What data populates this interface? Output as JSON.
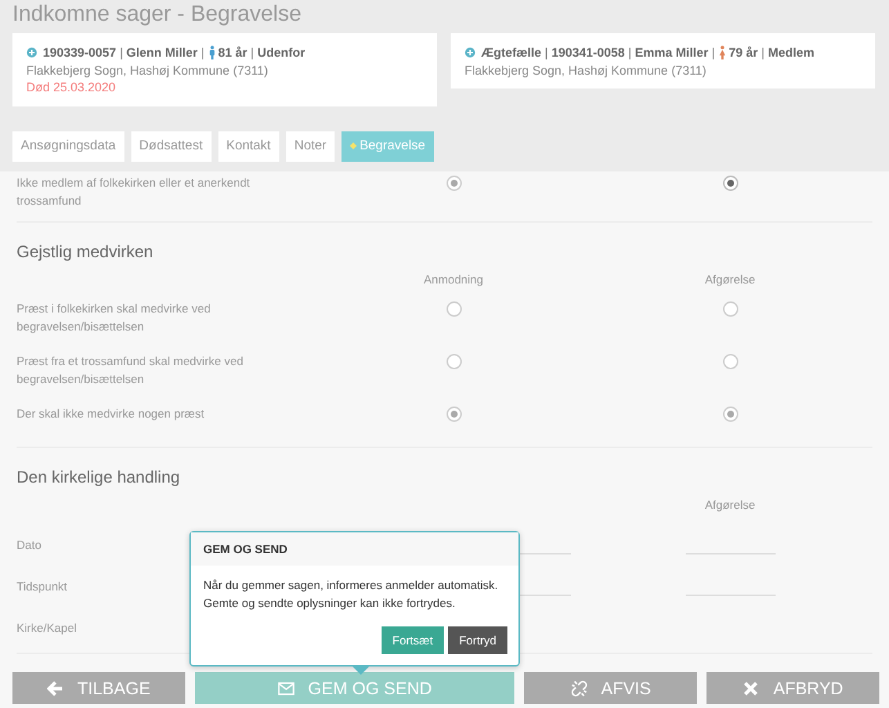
{
  "title": "Indkomne sager - Begravelse",
  "persons": [
    {
      "kind": "male",
      "identity": "**190339-0057** | **Glenn Miller** |",
      "age": "**81 år** | **Udenfor**",
      "address": "Flakkebjerg Sogn, Hashøj Kommune (7311)",
      "death": "Død 25.03.2020"
    },
    {
      "kind": "female",
      "identity": "**Ægtefælle** | **190341-0058** | **Emma Miller** |",
      "age": "**79 år** | **Medlem**",
      "address": "Flakkebjerg Sogn, Hashøj Kommune (7311)"
    }
  ],
  "tabs": [
    {
      "label": "Ansøgningsdata",
      "selected": false
    },
    {
      "label": "Dødsattest",
      "selected": false
    },
    {
      "label": "Kontakt",
      "selected": false
    },
    {
      "label": "Noter",
      "selected": false
    },
    {
      "label": "Begravelse",
      "selected": true
    }
  ],
  "sections": [
    {
      "rows": [
        {
          "kind": "radio",
          "label": "Ikke medlem af folkekirken eller et anerkendt trossamfund",
          "request": {
            "selected": true,
            "disabled": true
          },
          "decision": {
            "selected": true,
            "disabled": false
          }
        }
      ]
    },
    {
      "heading": "Gejstlig medvirken",
      "columns": [
        "Anmodning",
        "Afgørelse"
      ],
      "rows": [
        {
          "kind": "radio",
          "label": "Præst i folkekirken skal medvirke ved begravelsen/bisættelsen",
          "request": {
            "selected": false,
            "disabled": true
          },
          "decision": {
            "selected": false,
            "disabled": true
          }
        },
        {
          "kind": "radio",
          "label": "Præst fra et trossamfund skal medvirke ved begravelsen/bisættelsen",
          "request": {
            "selected": false,
            "disabled": true
          },
          "decision": {
            "selected": false,
            "disabled": true
          }
        },
        {
          "kind": "radio",
          "label": "Der skal ikke medvirke nogen præst",
          "request": {
            "selected": true,
            "disabled": true
          },
          "decision": {
            "selected": true,
            "disabled": true
          }
        }
      ]
    },
    {
      "heading": "Den kirkelige handling",
      "columns": [
        "",
        "Afgørelse"
      ],
      "rows": [
        {
          "kind": "field",
          "label": "Dato"
        },
        {
          "kind": "field",
          "label": "Tidspunkt"
        },
        {
          "kind": "text",
          "label": "Kirke/Kapel"
        }
      ]
    }
  ],
  "popover": {
    "title": "GEM OG SEND",
    "text": "Når du gemmer sagen, informeres anmelder automatisk.\nGemte og sendte oplysninger kan ikke fortrydes.",
    "buttons": [
      {
        "label": "Fortsæt",
        "kind": "primary"
      },
      {
        "label": "Fortryd",
        "kind": "secondary"
      }
    ]
  },
  "footer": [
    {
      "label": "TILBAGE",
      "kind": "default"
    },
    {
      "label": "GEM OG SEND",
      "kind": "primary"
    },
    {
      "label": "AFVIS",
      "kind": "default"
    },
    {
      "label": "AFBRYD",
      "kind": "default"
    }
  ]
}
